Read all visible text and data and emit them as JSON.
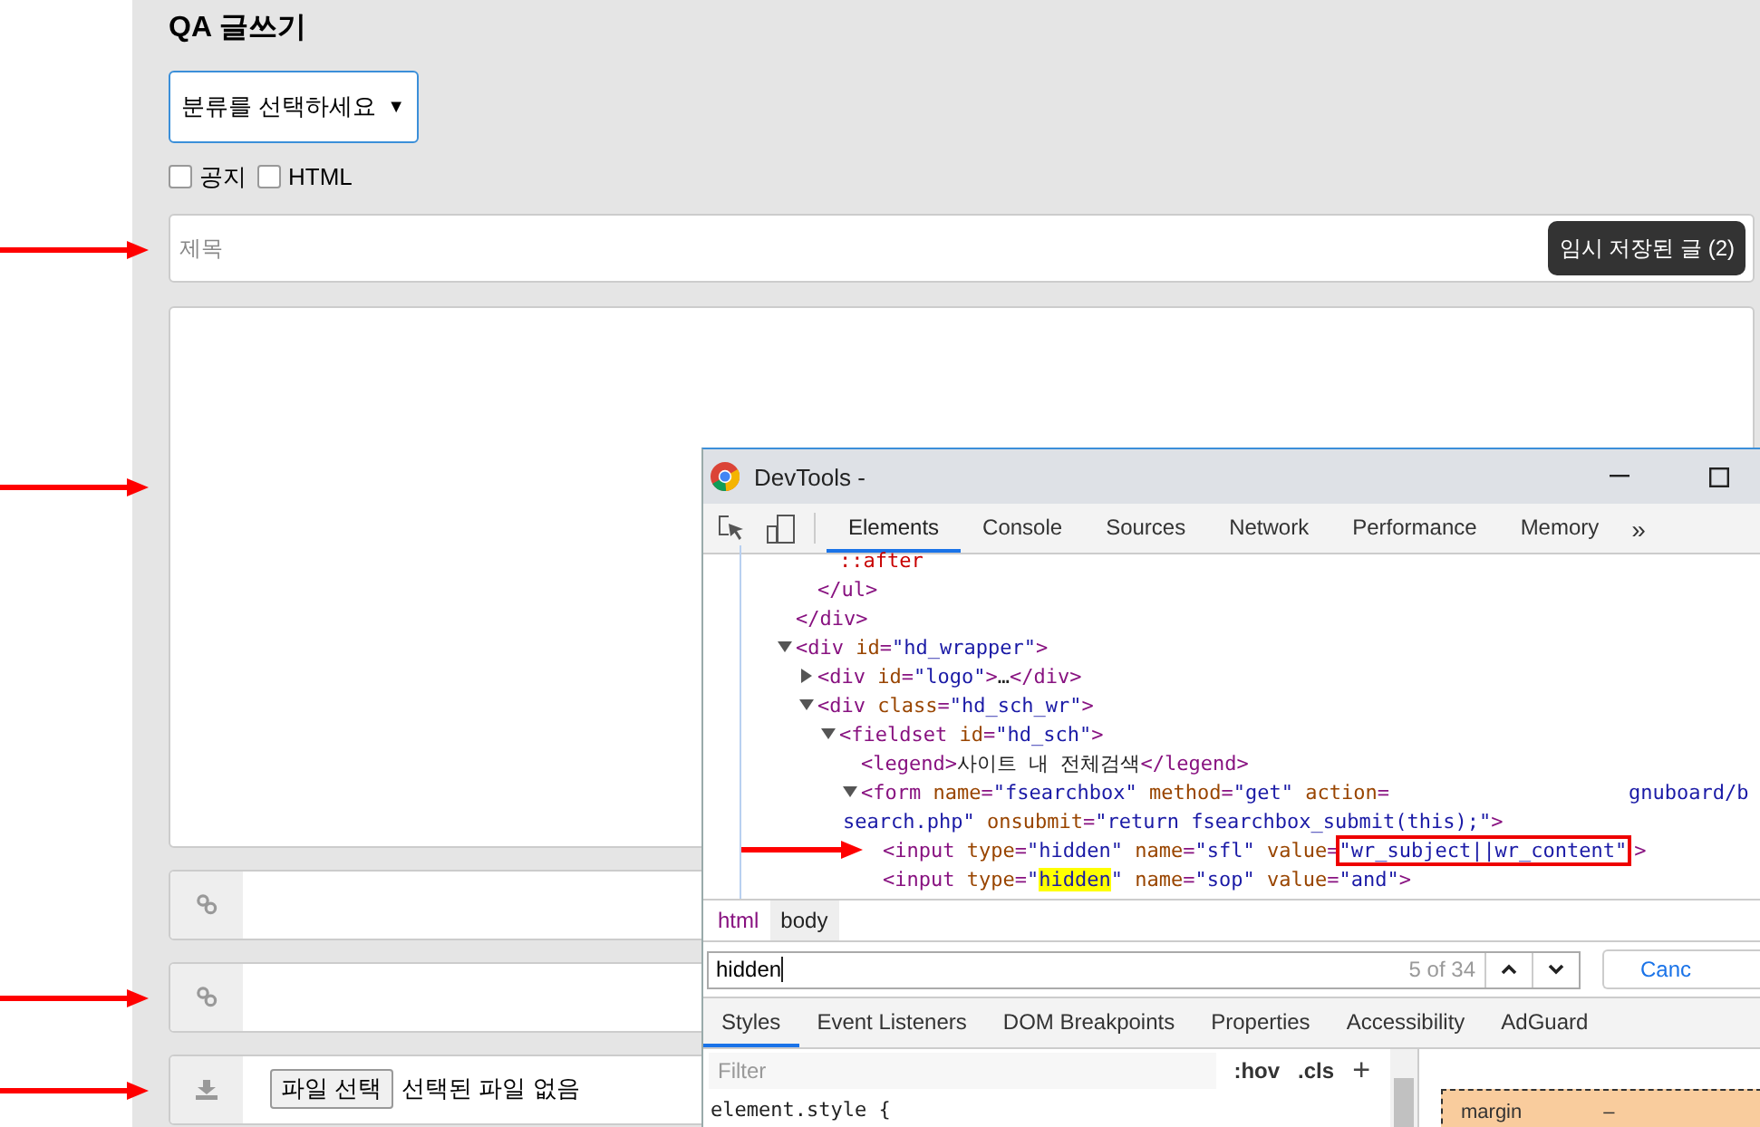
{
  "page": {
    "title": "QA 글쓰기",
    "category_select": {
      "value": "분류를 선택하세요",
      "caret": "▼"
    },
    "options": [
      {
        "label": "공지",
        "checked": false
      },
      {
        "label": "HTML",
        "checked": false
      }
    ],
    "subject": {
      "placeholder": "제목",
      "marked": true,
      "draft_button": "임시 저장된 글 (2)"
    },
    "content": {
      "marked": true
    },
    "links": [
      {
        "marked": false
      },
      {
        "marked": true
      }
    ],
    "file": {
      "marked": true,
      "button": "파일 선택",
      "status": "선택된 파일 없음"
    }
  },
  "devtools": {
    "title": "DevTools -",
    "tabs": [
      {
        "label": "Elements",
        "selected": true
      },
      {
        "label": "Console",
        "selected": false
      },
      {
        "label": "Sources",
        "selected": false
      },
      {
        "label": "Network",
        "selected": false
      },
      {
        "label": "Performance",
        "selected": false
      },
      {
        "label": "Memory",
        "selected": false
      }
    ],
    "more": "»",
    "dom_tree": [
      {
        "children": [
          {
            "children": [
              {
                "marked": false,
                "tokens": [
                  {
                    "kind": "pseudo",
                    "t": "::after"
                  }
                ]
              }
            ],
            "closing": [
              {
                "kind": "tag",
                "t": "</ul>"
              }
            ]
          }
        ],
        "closing": [
          {
            "kind": "tag",
            "t": "</div>"
          }
        ]
      },
      {
        "marked": false,
        "expanded": true,
        "tokens": [
          {
            "kind": "tag",
            "t": "<div "
          },
          {
            "kind": "attr",
            "t": "id"
          },
          {
            "kind": "tag",
            "t": "="
          },
          {
            "kind": "value",
            "t": "\"hd_wrapper\""
          },
          {
            "kind": "tag",
            "t": ">"
          }
        ],
        "children": [
          {
            "marked": false,
            "expanded": false,
            "tokens": [
              {
                "kind": "tag",
                "t": "<div "
              },
              {
                "kind": "attr",
                "t": "id"
              },
              {
                "kind": "tag",
                "t": "="
              },
              {
                "kind": "value",
                "t": "\"logo\""
              },
              {
                "kind": "tag",
                "t": ">"
              },
              {
                "kind": "text",
                "t": "…"
              },
              {
                "kind": "tag",
                "t": "</div>"
              }
            ]
          },
          {
            "marked": false,
            "expanded": true,
            "tokens": [
              {
                "kind": "tag",
                "t": "<div "
              },
              {
                "kind": "attr",
                "t": "class"
              },
              {
                "kind": "tag",
                "t": "="
              },
              {
                "kind": "value",
                "t": "\"hd_sch_wr\""
              },
              {
                "kind": "tag",
                "t": ">"
              }
            ],
            "children": [
              {
                "marked": false,
                "expanded": true,
                "tokens": [
                  {
                    "kind": "tag",
                    "t": "<fieldset "
                  },
                  {
                    "kind": "attr",
                    "t": "id"
                  },
                  {
                    "kind": "tag",
                    "t": "="
                  },
                  {
                    "kind": "value",
                    "t": "\"hd_sch\""
                  },
                  {
                    "kind": "tag",
                    "t": ">"
                  }
                ],
                "children": [
                  {
                    "marked": false,
                    "tokens": [
                      {
                        "kind": "tag",
                        "t": "<legend>"
                      },
                      {
                        "kind": "text",
                        "t": "사이트 내 전체검색"
                      },
                      {
                        "kind": "tag",
                        "t": "</legend>"
                      }
                    ]
                  },
                  {
                    "marked": false,
                    "expanded": true,
                    "tokens": [
                      {
                        "kind": "tag",
                        "t": "<form "
                      },
                      {
                        "kind": "attr",
                        "t": "name"
                      },
                      {
                        "kind": "tag",
                        "t": "="
                      },
                      {
                        "kind": "value",
                        "t": "\"fsearchbox\" "
                      },
                      {
                        "kind": "attr",
                        "t": "method"
                      },
                      {
                        "kind": "tag",
                        "t": "="
                      },
                      {
                        "kind": "value",
                        "t": "\"get\" "
                      },
                      {
                        "kind": "attr",
                        "t": "action"
                      },
                      {
                        "kind": "tag",
                        "t": "="
                      },
                      {
                        "kind": "cut_value",
                        "t": "gnuboard/b"
                      }
                    ],
                    "continuation": [
                      {
                        "kind": "value",
                        "t": "search.php\" "
                      },
                      {
                        "kind": "attr",
                        "t": "onsubmit"
                      },
                      {
                        "kind": "tag",
                        "t": "="
                      },
                      {
                        "kind": "value",
                        "t": "\"return fsearchbox_submit(this);\""
                      },
                      {
                        "kind": "tag",
                        "t": ">"
                      }
                    ],
                    "children": [
                      {
                        "marked": true,
                        "tokens": [
                          {
                            "kind": "tag",
                            "t": "<input "
                          },
                          {
                            "kind": "attr",
                            "t": "type"
                          },
                          {
                            "kind": "tag",
                            "t": "="
                          },
                          {
                            "kind": "value",
                            "t": "\"hidden\" "
                          },
                          {
                            "kind": "attr",
                            "t": "name"
                          },
                          {
                            "kind": "tag",
                            "t": "="
                          },
                          {
                            "kind": "value",
                            "t": "\"sfl\" "
                          },
                          {
                            "kind": "attr",
                            "t": "value"
                          },
                          {
                            "kind": "tag",
                            "t": "="
                          },
                          {
                            "kind": "boxed",
                            "t": "\"wr_subject||wr_content\""
                          },
                          {
                            "kind": "tag",
                            "t": ">"
                          }
                        ]
                      },
                      {
                        "marked": false,
                        "tokens": [
                          {
                            "kind": "tag",
                            "t": "<input "
                          },
                          {
                            "kind": "attr",
                            "t": "type"
                          },
                          {
                            "kind": "tag",
                            "t": "="
                          },
                          {
                            "kind": "value",
                            "t": "\""
                          },
                          {
                            "kind": "match",
                            "t": "hidden"
                          },
                          {
                            "kind": "value",
                            "t": "\" "
                          },
                          {
                            "kind": "attr",
                            "t": "name"
                          },
                          {
                            "kind": "tag",
                            "t": "="
                          },
                          {
                            "kind": "value",
                            "t": "\"sop\" "
                          },
                          {
                            "kind": "attr",
                            "t": "value"
                          },
                          {
                            "kind": "tag",
                            "t": "="
                          },
                          {
                            "kind": "value",
                            "t": "\"and\""
                          },
                          {
                            "kind": "tag",
                            "t": ">"
                          }
                        ]
                      }
                    ]
                  }
                ]
              }
            ]
          }
        ]
      }
    ],
    "breadcrumbs": [
      {
        "label": "html",
        "selected": false
      },
      {
        "label": "body",
        "selected": true
      }
    ],
    "search": {
      "value": "hidden",
      "count": "5 of 34",
      "cancel": "Canc"
    },
    "panel_tabs": [
      {
        "label": "Styles",
        "selected": true
      },
      {
        "label": "Event Listeners",
        "selected": false
      },
      {
        "label": "DOM Breakpoints",
        "selected": false
      },
      {
        "label": "Properties",
        "selected": false
      },
      {
        "label": "Accessibility",
        "selected": false
      },
      {
        "label": "AdGuard",
        "selected": false
      }
    ],
    "styles": {
      "filter_placeholder": "Filter",
      "hov": ":hov",
      "cls": ".cls",
      "add": "+",
      "rule": "element.style {"
    },
    "box_model": {
      "label": "margin",
      "value": "–"
    }
  }
}
